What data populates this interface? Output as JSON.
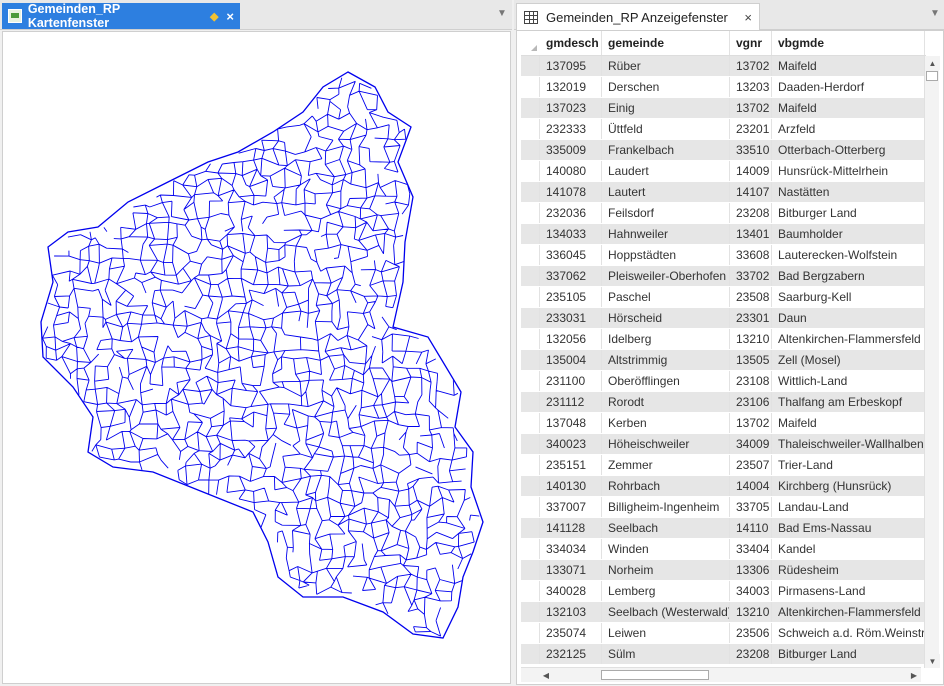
{
  "map_window": {
    "tab_title": "Gemeinden_RP Kartenfenster",
    "pin_icon": "diamond-pin-icon",
    "close_label": "×",
    "outline_color": "#0000ee"
  },
  "table_window": {
    "tab_title": "Gemeinden_RP Anzeigefenster",
    "close_label": "×",
    "columns": [
      "gmdesch",
      "gemeinde",
      "vgnr",
      "vbgmde"
    ],
    "rows": [
      [
        "137095",
        "Rüber",
        "13702",
        "Maifeld"
      ],
      [
        "132019",
        "Derschen",
        "13203",
        "Daaden-Herdorf"
      ],
      [
        "137023",
        "Einig",
        "13702",
        "Maifeld"
      ],
      [
        "232333",
        "Üttfeld",
        "23201",
        "Arzfeld"
      ],
      [
        "335009",
        "Frankelbach",
        "33510",
        "Otterbach-Otterberg"
      ],
      [
        "140080",
        "Laudert",
        "14009",
        "Hunsrück-Mittelrhein"
      ],
      [
        "141078",
        "Lautert",
        "14107",
        "Nastätten"
      ],
      [
        "232036",
        "Feilsdorf",
        "23208",
        "Bitburger Land"
      ],
      [
        "134033",
        "Hahnweiler",
        "13401",
        "Baumholder"
      ],
      [
        "336045",
        "Hoppstädten",
        "33608",
        "Lauterecken-Wolfstein"
      ],
      [
        "337062",
        "Pleisweiler-Oberhofen",
        "33702",
        "Bad Bergzabern"
      ],
      [
        "235105",
        "Paschel",
        "23508",
        "Saarburg-Kell"
      ],
      [
        "233031",
        "Hörscheid",
        "23301",
        "Daun"
      ],
      [
        "132056",
        "Idelberg",
        "13210",
        "Altenkirchen-Flammersfeld"
      ],
      [
        "135004",
        "Altstrimmig",
        "13505",
        "Zell (Mosel)"
      ],
      [
        "231100",
        "Oberöfflingen",
        "23108",
        "Wittlich-Land"
      ],
      [
        "231112",
        "Rorodt",
        "23106",
        "Thalfang am Erbeskopf"
      ],
      [
        "137048",
        "Kerben",
        "13702",
        "Maifeld"
      ],
      [
        "340023",
        "Höheischweiler",
        "34009",
        "Thaleischweiler-Wallhalben"
      ],
      [
        "235151",
        "Zemmer",
        "23507",
        "Trier-Land"
      ],
      [
        "140130",
        "Rohrbach",
        "14004",
        "Kirchberg (Hunsrück)"
      ],
      [
        "337007",
        "Billigheim-Ingenheim",
        "33705",
        "Landau-Land"
      ],
      [
        "141128",
        "Seelbach",
        "14110",
        "Bad Ems-Nassau"
      ],
      [
        "334034",
        "Winden",
        "33404",
        "Kandel"
      ],
      [
        "133071",
        "Norheim",
        "13306",
        "Rüdesheim"
      ],
      [
        "340028",
        "Lemberg",
        "34003",
        "Pirmasens-Land"
      ],
      [
        "132103",
        "Seelbach (Westerwald)",
        "13210",
        "Altenkirchen-Flammersfeld"
      ],
      [
        "235074",
        "Leiwen",
        "23506",
        "Schweich a.d. Röm.Weinstr."
      ],
      [
        "232125",
        "Sülm",
        "23208",
        "Bitburger Land"
      ]
    ]
  }
}
